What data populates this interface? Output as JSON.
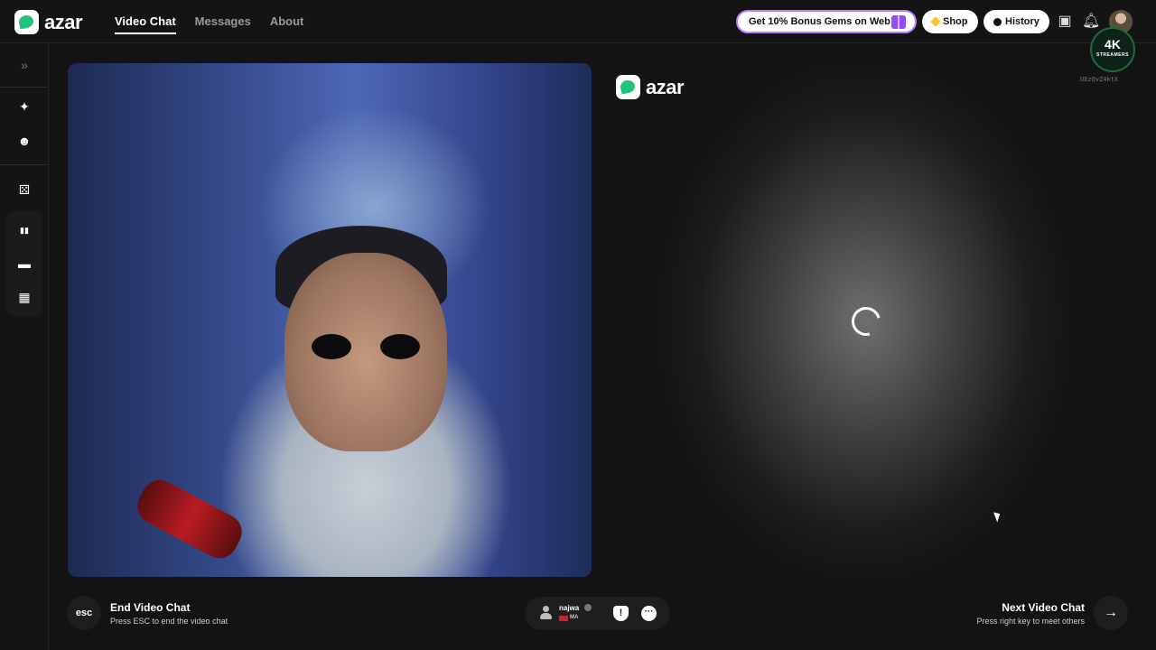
{
  "header": {
    "brand": "azar",
    "nav": [
      {
        "label": "Video Chat",
        "active": true
      },
      {
        "label": "Messages",
        "active": false
      },
      {
        "label": "About",
        "active": false
      }
    ],
    "promo_label": "Get 10% Bonus Gems on Web!",
    "shop_label": "Shop",
    "history_label": "History",
    "icons": [
      "archive-icon",
      "bell-icon",
      "profile-avatar"
    ]
  },
  "sidebar": {
    "items": [
      {
        "icon": "expand-chevrons-icon",
        "glyph": "»"
      },
      {
        "icon": "magic-wand-icon",
        "glyph": "✦"
      },
      {
        "icon": "face-filter-icon",
        "glyph": "☻"
      },
      {
        "icon": "dice-icon",
        "glyph": "⚄"
      },
      {
        "icon": "layout-side-by-side-icon",
        "glyph": "▮▮"
      },
      {
        "icon": "layout-stacked-icon",
        "glyph": "▬"
      },
      {
        "icon": "layout-grid-icon",
        "glyph": "▦"
      }
    ]
  },
  "right_panel": {
    "brand": "azar",
    "loading": true
  },
  "overlay": {
    "badge_text": "4K",
    "badge_sub": "STREAMERS",
    "user_code": "UEzQvZ4ktX"
  },
  "footer": {
    "esc_label": "esc",
    "end_title": "End Video Chat",
    "end_subtitle": "Press ESC to end the video chat",
    "peer": {
      "name": "najwa",
      "country": "MA"
    },
    "next_title": "Next Video Chat",
    "next_subtitle": "Press right key to meet others",
    "next_arrow": "→"
  },
  "colors": {
    "brand_green": "#21c27a",
    "promo_border": "#b87cff",
    "gem": "#ffc12b"
  }
}
